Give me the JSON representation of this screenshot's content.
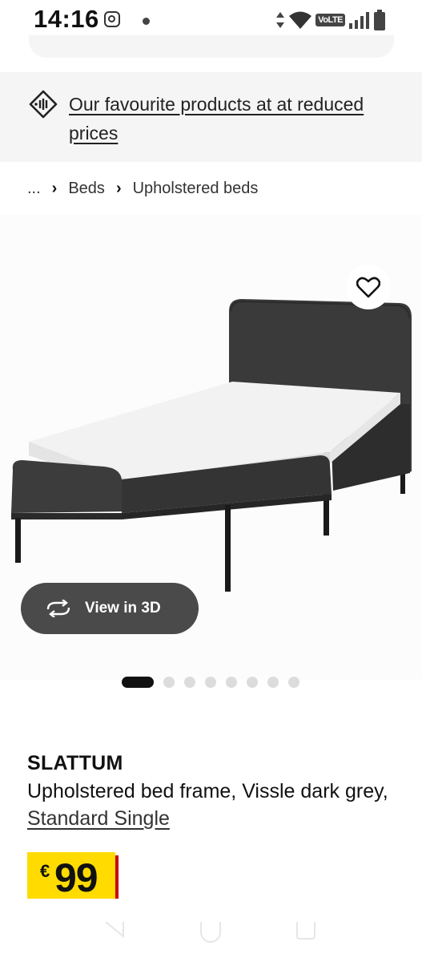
{
  "status_bar": {
    "time": "14:16",
    "volte_label": "VoLTE",
    "icons": [
      "instagram-icon",
      "notification-dot-icon",
      "data-arrows-icon",
      "wifi-icon",
      "signal-icon",
      "battery-icon"
    ]
  },
  "promo": {
    "text": "Our favourite products at at reduced prices",
    "icon": "price-tag-icon"
  },
  "breadcrumb": {
    "items": [
      "...",
      "Beds",
      "Upholstered beds"
    ]
  },
  "gallery": {
    "view_in_3d_label": "View in 3D",
    "dot_count": 8,
    "active_index": 0,
    "favourite_icon": "heart-icon"
  },
  "product": {
    "name": "SLATTUM",
    "description": "Upholstered bed frame, Vissle dark grey, ",
    "size_label": "Standard Single",
    "price_currency": "€",
    "price_amount": "99"
  },
  "colors": {
    "price_highlight": "#ffdb00",
    "price_accent": "#cc0008",
    "button_bg": "#4a4a4a",
    "promo_bg": "#f5f5f5"
  }
}
